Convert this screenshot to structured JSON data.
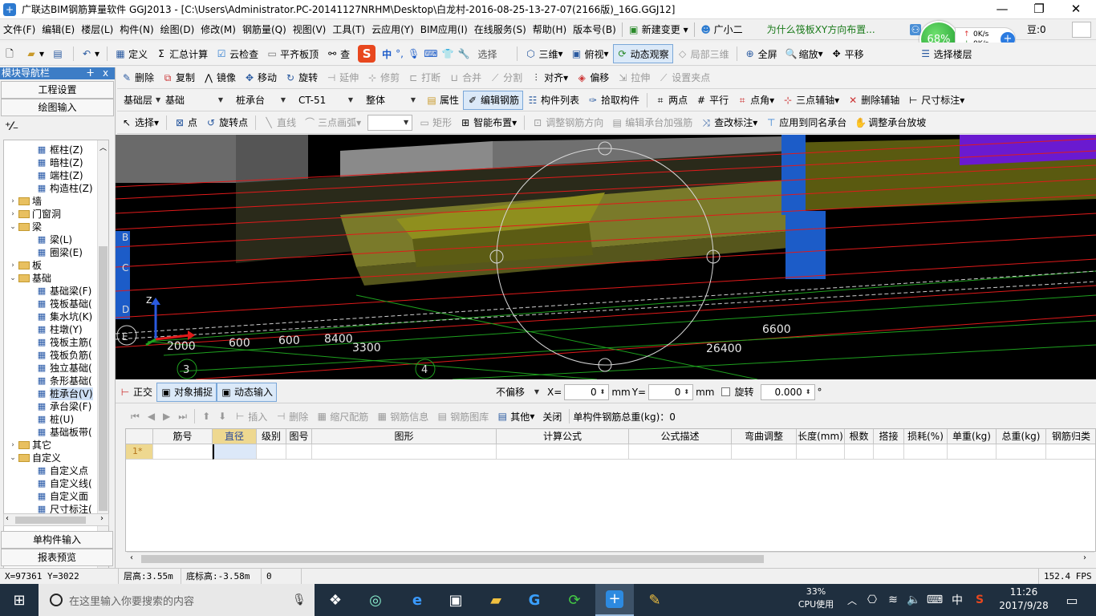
{
  "window": {
    "title": "广联达BIM钢筋算量软件 GGJ2013 - [C:\\Users\\Administrator.PC-20141127NRHM\\Desktop\\白龙村-2016-08-25-13-27-07(2166版)_16G.GGJ12]",
    "btn_minimize": "—",
    "btn_restore": "❐",
    "btn_close": "✕"
  },
  "overlay": {
    "percent": "68%",
    "up": "0K/s",
    "down": "0K/s"
  },
  "menu": {
    "items": [
      "文件(F)",
      "编辑(E)",
      "楼层(L)",
      "构件(N)",
      "绘图(D)",
      "修改(M)",
      "钢筋量(Q)",
      "视图(V)",
      "工具(T)",
      "云应用(Y)",
      "BIM应用(I)",
      "在线服务(S)",
      "帮助(H)",
      "版本号(B)"
    ],
    "new_change": "新建变更",
    "assistant": "广小二",
    "hint": "为什么筏板XY方向布置...",
    "right_text": "豆:0"
  },
  "toolbar1": {
    "define": "定义",
    "calc": "汇总计算",
    "cloud_check": "云检查",
    "flush_top": "平齐板顶",
    "find_prefix": "查",
    "select_layer_partial": "选择",
    "view3d": "三维",
    "top_view": "俯视",
    "dynamic_view": "动态观察",
    "local3d": "局部三维",
    "fullscreen": "全屏",
    "zoom": "缩放",
    "pan": "平移",
    "select_floor": "选择楼层"
  },
  "toolbar2": {
    "delete": "删除",
    "copy": "复制",
    "mirror": "镜像",
    "move": "移动",
    "rotate": "旋转",
    "extend": "延伸",
    "trim": "修剪",
    "break": "打断",
    "merge": "合并",
    "split": "分割",
    "align": "对齐",
    "offset": "偏移",
    "stretch": "拉伸",
    "set_insert": "设置夹点"
  },
  "toolbar3": {
    "floor": "基础层",
    "category": "基础",
    "element_type": "桩承台",
    "element": "CT-51",
    "part": "整体",
    "properties": "属性",
    "edit_rebar": "编辑钢筋",
    "element_list": "构件列表",
    "pick_element": "拾取构件",
    "two_points": "两点",
    "parallel": "平行",
    "point_angle": "点角",
    "three_point_axis": "三点辅轴",
    "delete_axis": "删除辅轴",
    "dim": "尺寸标注"
  },
  "toolbar4": {
    "select": "选择",
    "point": "点",
    "rotate_point": "旋转点",
    "line": "直线",
    "arc": "三点画弧",
    "rect": "矩形",
    "smart_layout": "智能布置",
    "adjust_dir": "调整钢筋方向",
    "edit_cap": "编辑承台加强筋",
    "change_mark": "查改标注",
    "apply_same": "应用到同名承台",
    "adjust_slope": "调整承台放坡"
  },
  "leftpanel": {
    "title": "模块导航栏",
    "pin": "ᵖ",
    "close": "x",
    "project_settings": "工程设置",
    "drawing_input": "绘图输入",
    "single_input": "单构件输入",
    "report": "报表预览"
  },
  "tree": [
    {
      "label": "框柱(Z)",
      "level": 2,
      "icon": "column-icon"
    },
    {
      "label": "暗柱(Z)",
      "level": 2,
      "icon": "column-icon"
    },
    {
      "label": "端柱(Z)",
      "level": 2,
      "icon": "column-icon"
    },
    {
      "label": "构造柱(Z)",
      "level": 2,
      "icon": "column-icon"
    },
    {
      "label": "墙",
      "level": 1,
      "toggle": "›"
    },
    {
      "label": "门窗洞",
      "level": 1,
      "toggle": "›"
    },
    {
      "label": "梁",
      "level": 1,
      "toggle": "⌄"
    },
    {
      "label": "梁(L)",
      "level": 2,
      "icon": "beam-icon"
    },
    {
      "label": "圈梁(E)",
      "level": 2,
      "icon": "beam-icon"
    },
    {
      "label": "板",
      "level": 1,
      "toggle": "›"
    },
    {
      "label": "基础",
      "level": 1,
      "toggle": "⌄"
    },
    {
      "label": "基础梁(F)",
      "level": 2,
      "icon": "beam-icon"
    },
    {
      "label": "筏板基础(",
      "level": 2,
      "icon": "slab-icon"
    },
    {
      "label": "集水坑(K)",
      "level": 2,
      "icon": "pit-icon"
    },
    {
      "label": "柱墩(Y)",
      "level": 2,
      "icon": "pier-icon"
    },
    {
      "label": "筏板主筋(",
      "level": 2,
      "icon": "grid-icon"
    },
    {
      "label": "筏板负筋(",
      "level": 2,
      "icon": "grid-icon"
    },
    {
      "label": "独立基础(",
      "level": 2,
      "icon": "footing-icon"
    },
    {
      "label": "条形基础(",
      "level": 2,
      "icon": "footing-icon"
    },
    {
      "label": "桩承台(V)",
      "level": 2,
      "icon": "pilecap-icon"
    },
    {
      "label": "承台梁(F)",
      "level": 2,
      "icon": "beam-icon"
    },
    {
      "label": "桩(U)",
      "level": 2,
      "icon": "pile-icon"
    },
    {
      "label": "基础板带(",
      "level": 2,
      "icon": "grid-icon"
    },
    {
      "label": "其它",
      "level": 1,
      "toggle": "›"
    },
    {
      "label": "自定义",
      "level": 1,
      "toggle": "⌄"
    },
    {
      "label": "自定义点",
      "level": 2,
      "icon": "point-icon"
    },
    {
      "label": "自定义线(",
      "level": 2,
      "icon": "line-icon"
    },
    {
      "label": "自定义面",
      "level": 2,
      "icon": "face-icon"
    },
    {
      "label": "尺寸标注(",
      "level": 2,
      "icon": "dim-icon"
    }
  ],
  "viewport": {
    "dims": [
      "2000",
      "600",
      "600",
      "8400",
      "3300",
      "6600",
      "26400"
    ],
    "axis_labels": [
      "3",
      "4",
      "B",
      "C",
      "D",
      "E"
    ],
    "axis_z": "Z"
  },
  "snapbar": {
    "ortho": "正交",
    "snap": "对象捕捉",
    "dyn_input": "动态输入",
    "offset_mode": "不偏移",
    "x_label": "X=",
    "x_value": "0",
    "y_label": "Y=",
    "y_value": "0",
    "unit": "mm",
    "rotate_label": "旋转",
    "rotate_value": "0.000",
    "degree": "°"
  },
  "gridtool": {
    "insert": "插入",
    "delete": "删除",
    "ruler": "缩尺配筋",
    "rebar_info": "钢筋信息",
    "rebar_lib": "钢筋图库",
    "other": "其他",
    "close": "关闭",
    "total": "单构件钢筋总重(kg)：0"
  },
  "grid": {
    "columns": [
      "筋号",
      "直径(mm)",
      "级别",
      "图号",
      "图形",
      "计算公式",
      "公式描述",
      "弯曲调整(mm)",
      "长度(mm)",
      "根数",
      "搭接",
      "损耗(%)",
      "单重(kg)",
      "总重(kg)",
      "钢筋归类"
    ],
    "row_label": "1*"
  },
  "status": {
    "coords": "X=97361 Y=3022",
    "floor_height": "层高:3.55m",
    "bottom_elev": "底标高:-3.58m",
    "zero": "0",
    "fps": "152.4 FPS"
  },
  "taskbar": {
    "search_placeholder": "在这里输入你要搜索的内容",
    "cpu_percent": "33%",
    "cpu_label": "CPU使用",
    "ime": "中",
    "time": "11:26",
    "date": "2017/9/28"
  },
  "colors": {
    "accent": "#3d7dc6",
    "viewport_bg": "#000000",
    "taskbar_bg": "#1f2f3f"
  }
}
